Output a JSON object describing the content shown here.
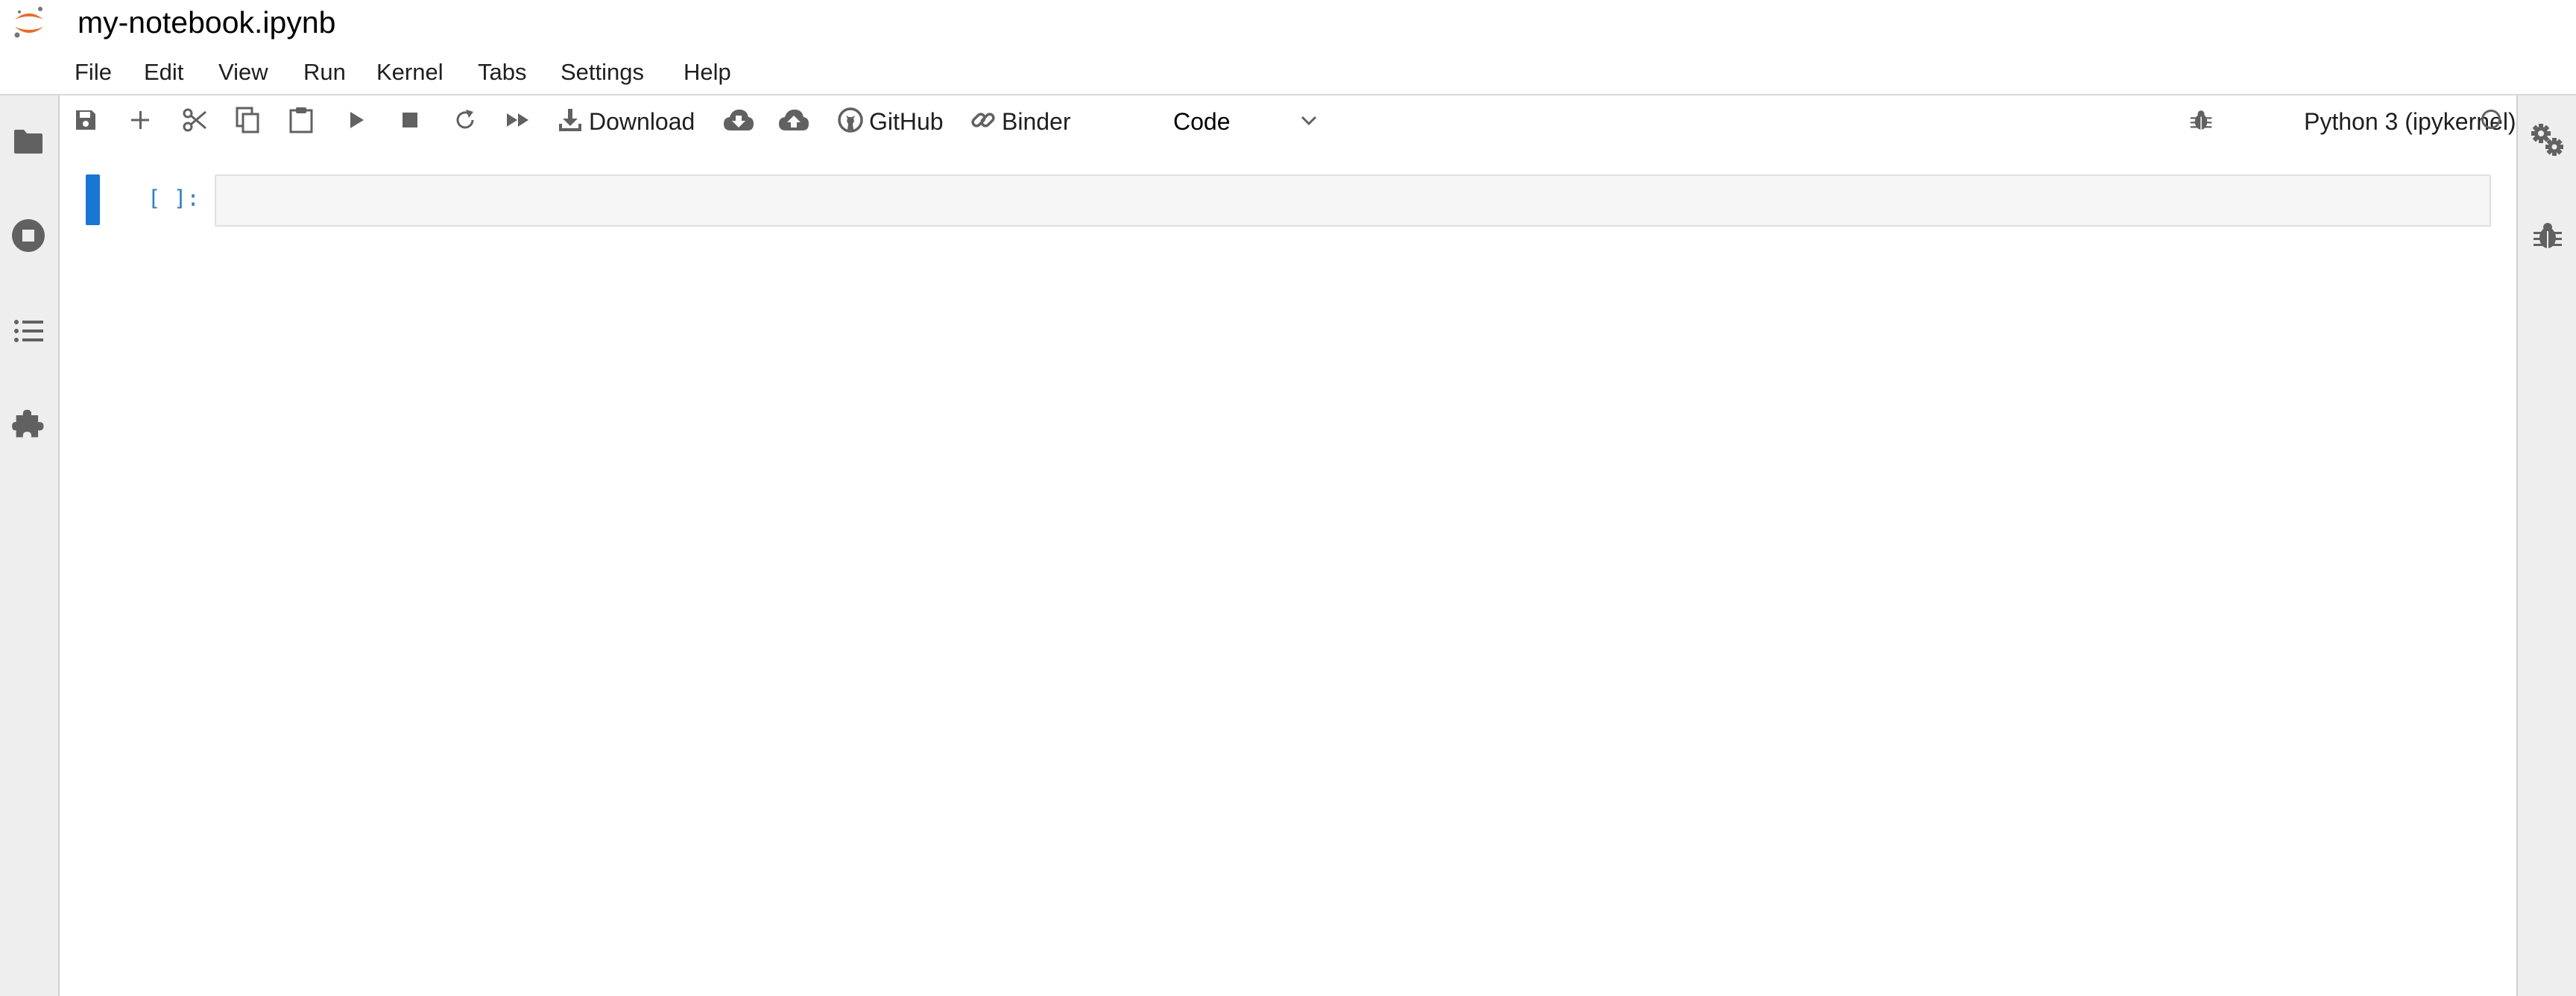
{
  "header": {
    "title": "my-notebook.ipynb",
    "logo_icon": "jupyter-logo-icon"
  },
  "menu": {
    "items": [
      {
        "label": "File"
      },
      {
        "label": "Edit"
      },
      {
        "label": "View"
      },
      {
        "label": "Run"
      },
      {
        "label": "Kernel"
      },
      {
        "label": "Tabs"
      },
      {
        "label": "Settings"
      },
      {
        "label": "Help"
      }
    ]
  },
  "toolbar": {
    "download_label": "Download",
    "github_label": "GitHub",
    "binder_label": "Binder",
    "cell_type": "Code",
    "kernel_name": "Python 3 (ipykernel)",
    "icons": [
      "save-icon",
      "add-icon",
      "cut-icon",
      "copy-icon",
      "paste-icon",
      "run-icon",
      "stop-icon",
      "restart-icon",
      "fast-forward-icon",
      "download-icon",
      "cloud-download-icon",
      "cloud-upload-icon",
      "github-icon",
      "link-icon",
      "chevron-down-icon",
      "bug-icon",
      "circle-icon"
    ]
  },
  "left_sidebar": {
    "icons": [
      "folder-icon",
      "stop-circle-icon",
      "list-icon",
      "puzzle-icon"
    ]
  },
  "right_sidebar": {
    "icons": [
      "gears-icon",
      "bug-icon"
    ]
  },
  "notebook": {
    "cells": [
      {
        "prompt": "[ ]:",
        "source": ""
      }
    ]
  },
  "colors": {
    "accent": "#1976d2",
    "prompt": "#307fc1",
    "logo": "#e46e2e",
    "icon": "#616161"
  }
}
